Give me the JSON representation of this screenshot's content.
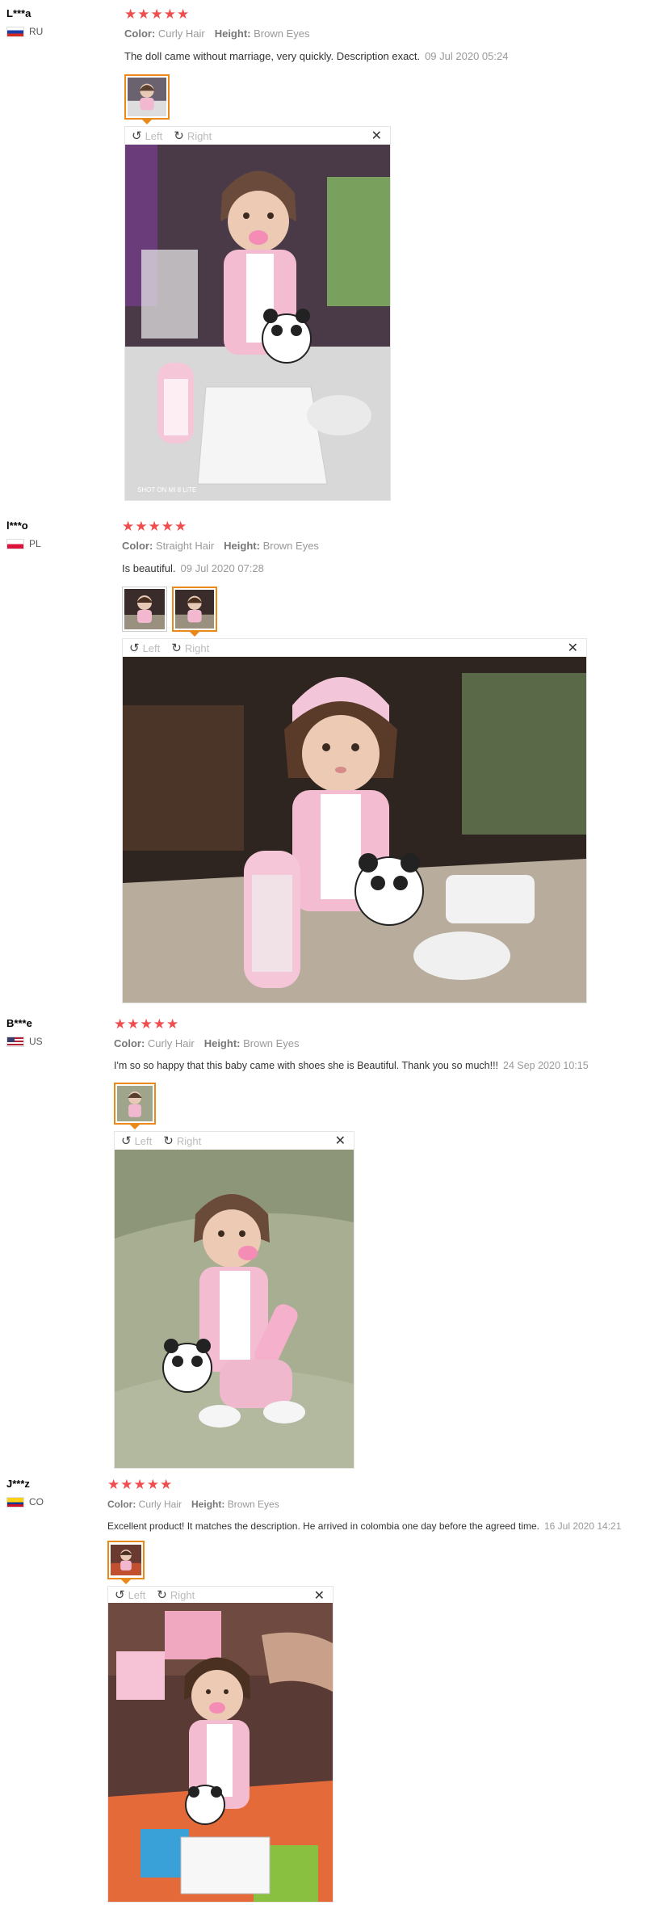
{
  "reviews": [
    {
      "user": "L***a",
      "country": "RU",
      "stars": "★★★★★",
      "attrs": {
        "color_label": "Color:",
        "color": "Curly Hair",
        "height_label": "Height:",
        "height": "Brown Eyes"
      },
      "text": "The doll came without marriage, very quickly. Description exact.",
      "date": "09 Jul 2020 05:24",
      "photo_caption": "SHOT ON MI 8 LITE"
    },
    {
      "user": "l***o",
      "country": "PL",
      "stars": "★★★★★",
      "attrs": {
        "color_label": "Color:",
        "color": "Straight Hair",
        "height_label": "Height:",
        "height": "Brown Eyes"
      },
      "text": "Is beautiful.",
      "date": "09 Jul 2020 07:28"
    },
    {
      "user": "B***e",
      "country": "US",
      "stars": "★★★★★",
      "attrs": {
        "color_label": "Color:",
        "color": "Curly Hair",
        "height_label": "Height:",
        "height": "Brown Eyes"
      },
      "text": "I'm so so happy that this baby came with shoes she is Beautiful. Thank you so much!!!",
      "date": "24 Sep 2020 10:15"
    },
    {
      "user": "J***z",
      "country": "CO",
      "stars": "★★★★★",
      "attrs": {
        "color_label": "Color:",
        "color": "Curly Hair",
        "height_label": "Height:",
        "height": "Brown Eyes"
      },
      "text": "Excellent product! It matches the description. He arrived in colombia one day before the agreed time.",
      "date": "16 Jul 2020 14:21"
    }
  ],
  "viewer": {
    "left_label": "Left",
    "right_label": "Right",
    "rotate_left_icon": "rotate-left-icon",
    "rotate_right_icon": "rotate-right-icon",
    "close_icon": "close-icon"
  },
  "colors": {
    "stars": "#f04e4e",
    "thumb_active": "#e8891a",
    "muted": "#999999"
  }
}
